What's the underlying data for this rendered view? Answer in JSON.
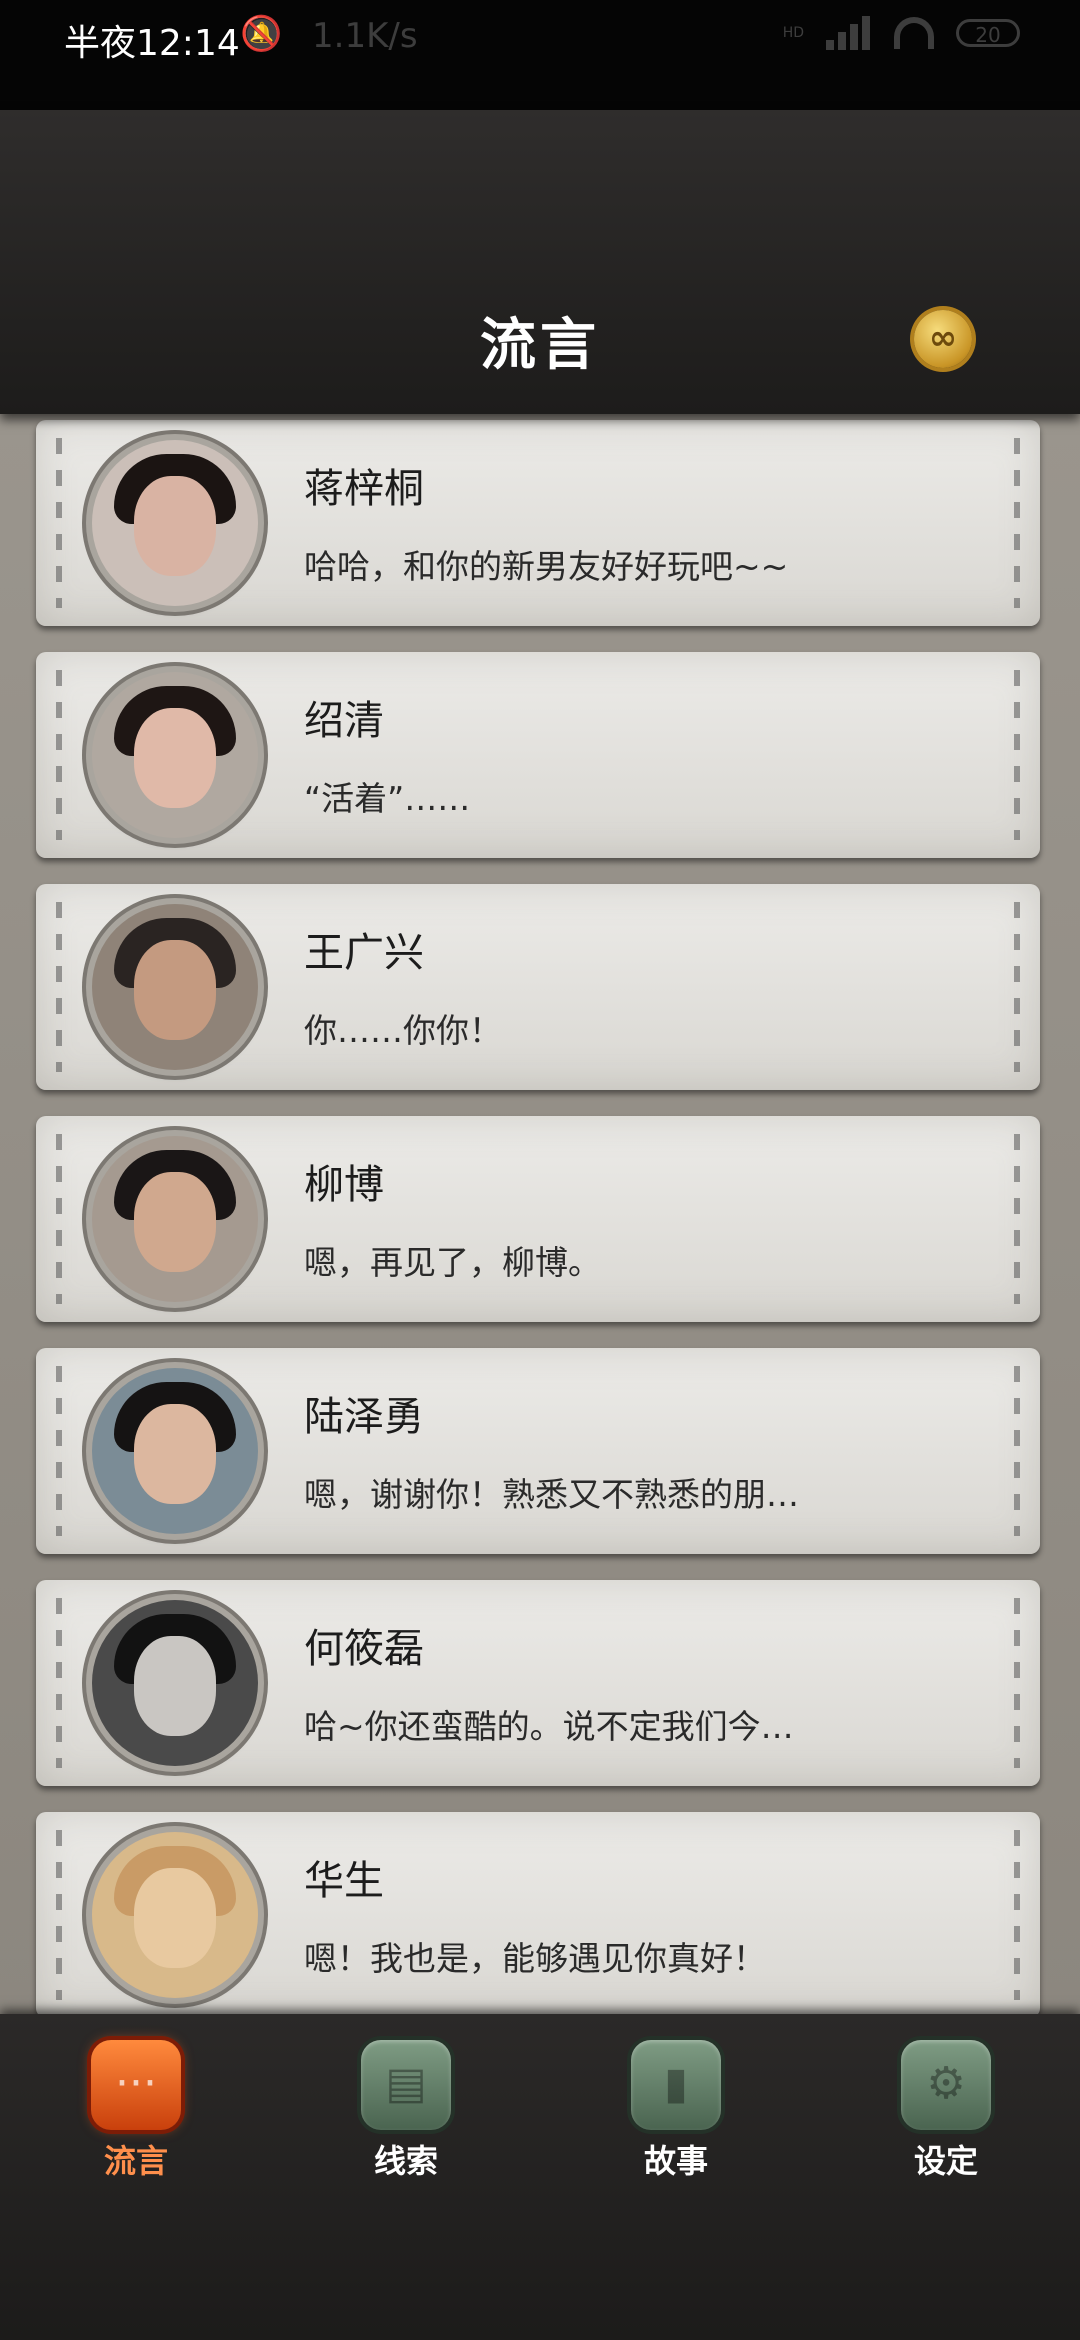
{
  "status_bar": {
    "time": "半夜12:14",
    "speed": "1.1K/s",
    "network": "HD",
    "battery": "20"
  },
  "header": {
    "title": "流言",
    "coin_icon": "infinity-coin-icon"
  },
  "messages": [
    {
      "name": "蒋梓桐",
      "text": "哈哈，和你的新男友好好玩吧~~",
      "avatar_skin": "#d9b3a3",
      "avatar_hair": "#1b1412",
      "avatar_bg": "#cbbfb8"
    },
    {
      "name": "绍清",
      "text": "“活着”……",
      "avatar_skin": "#e0b9a8",
      "avatar_hair": "#1e1614",
      "avatar_bg": "#b0a8a0"
    },
    {
      "name": "王广兴",
      "text": "你……你你！",
      "avatar_skin": "#c49a80",
      "avatar_hair": "#2a2422",
      "avatar_bg": "#8f8378"
    },
    {
      "name": "柳博",
      "text": "嗯，再见了，柳博。",
      "avatar_skin": "#d0a88e",
      "avatar_hair": "#1a1616",
      "avatar_bg": "#a59a90"
    },
    {
      "name": "陆泽勇",
      "text": "嗯，谢谢你！熟悉又不熟悉的朋…",
      "avatar_skin": "#dcb79f",
      "avatar_hair": "#151313",
      "avatar_bg": "#7b8c96"
    },
    {
      "name": "何筱磊",
      "text": "哈~你还蛮酷的。说不定我们今…",
      "avatar_skin": "#c9c6c2",
      "avatar_hair": "#121212",
      "avatar_bg": "#4a4a4a"
    },
    {
      "name": "华生",
      "text": "嗯！我也是，能够遇见你真好！",
      "avatar_skin": "#e8c9a0",
      "avatar_hair": "#c99b66",
      "avatar_bg": "#d8b98a"
    }
  ],
  "nav": [
    {
      "label": "流言",
      "icon": "chat-bubble-icon",
      "active": true
    },
    {
      "label": "线索",
      "icon": "document-icon",
      "active": false
    },
    {
      "label": "故事",
      "icon": "book-icon",
      "active": false
    },
    {
      "label": "设定",
      "icon": "gear-icon",
      "active": false
    }
  ]
}
